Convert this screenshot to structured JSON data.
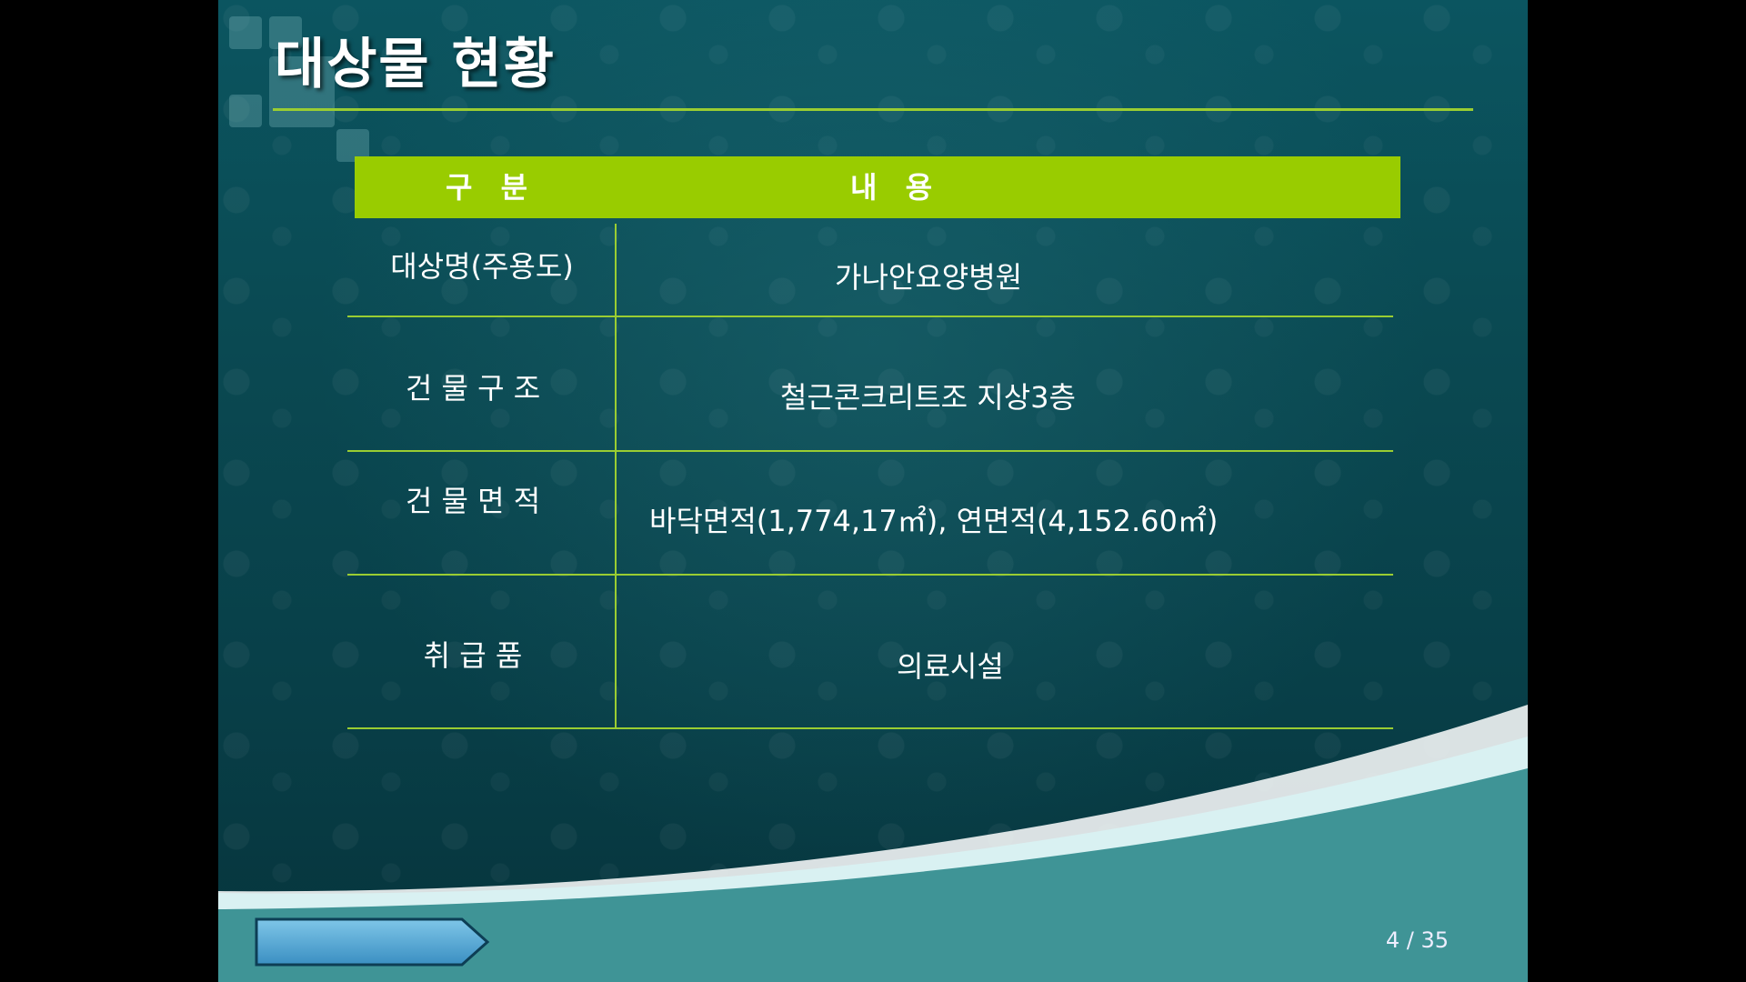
{
  "slide": {
    "title": "대상물 현황",
    "page_number": "4 / 35",
    "colors": {
      "accent": "#99cc00",
      "background": "#0a4952",
      "wave": "#3f9496"
    }
  },
  "table": {
    "headers": [
      "구 분",
      "내 용"
    ],
    "rows": [
      {
        "label": "대상명(주용도)",
        "value": "가나안요양병원"
      },
      {
        "label": "건 물 구 조",
        "value": "철근콘크리트조 지상3층"
      },
      {
        "label": "건 물 면 적",
        "value": "바닥면적(1,774,17㎡),  연면적(4,152.60㎡)"
      },
      {
        "label": "취  급  품",
        "value": "의료시설"
      }
    ]
  },
  "icons": {
    "nav": "arrow-right-icon"
  }
}
